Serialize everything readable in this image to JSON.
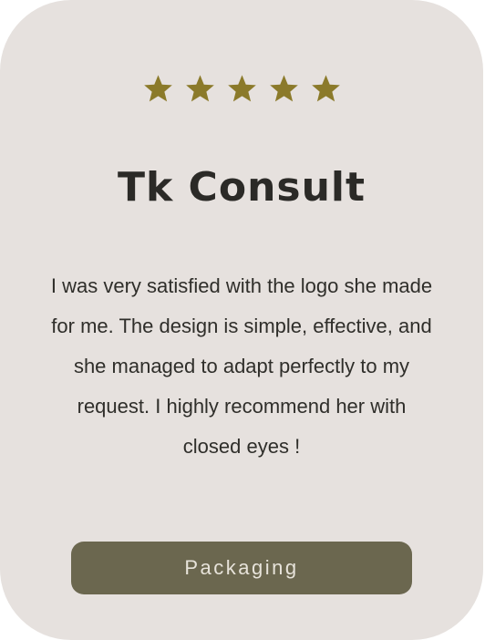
{
  "rating": {
    "stars": 5,
    "max": 5,
    "star_color": "#8b7a2a"
  },
  "testimonial": {
    "client_name": "Tk Consult",
    "text": "I was very satisfied with the logo she made for me. The design is simple, effective, and she managed to adapt perfectly to my request. I highly recommend her with closed eyes !"
  },
  "category_button": {
    "label": "Packaging"
  },
  "colors": {
    "card_background": "#e6e1de",
    "button_background": "#6b674f",
    "heading_text": "#2b2a27"
  }
}
